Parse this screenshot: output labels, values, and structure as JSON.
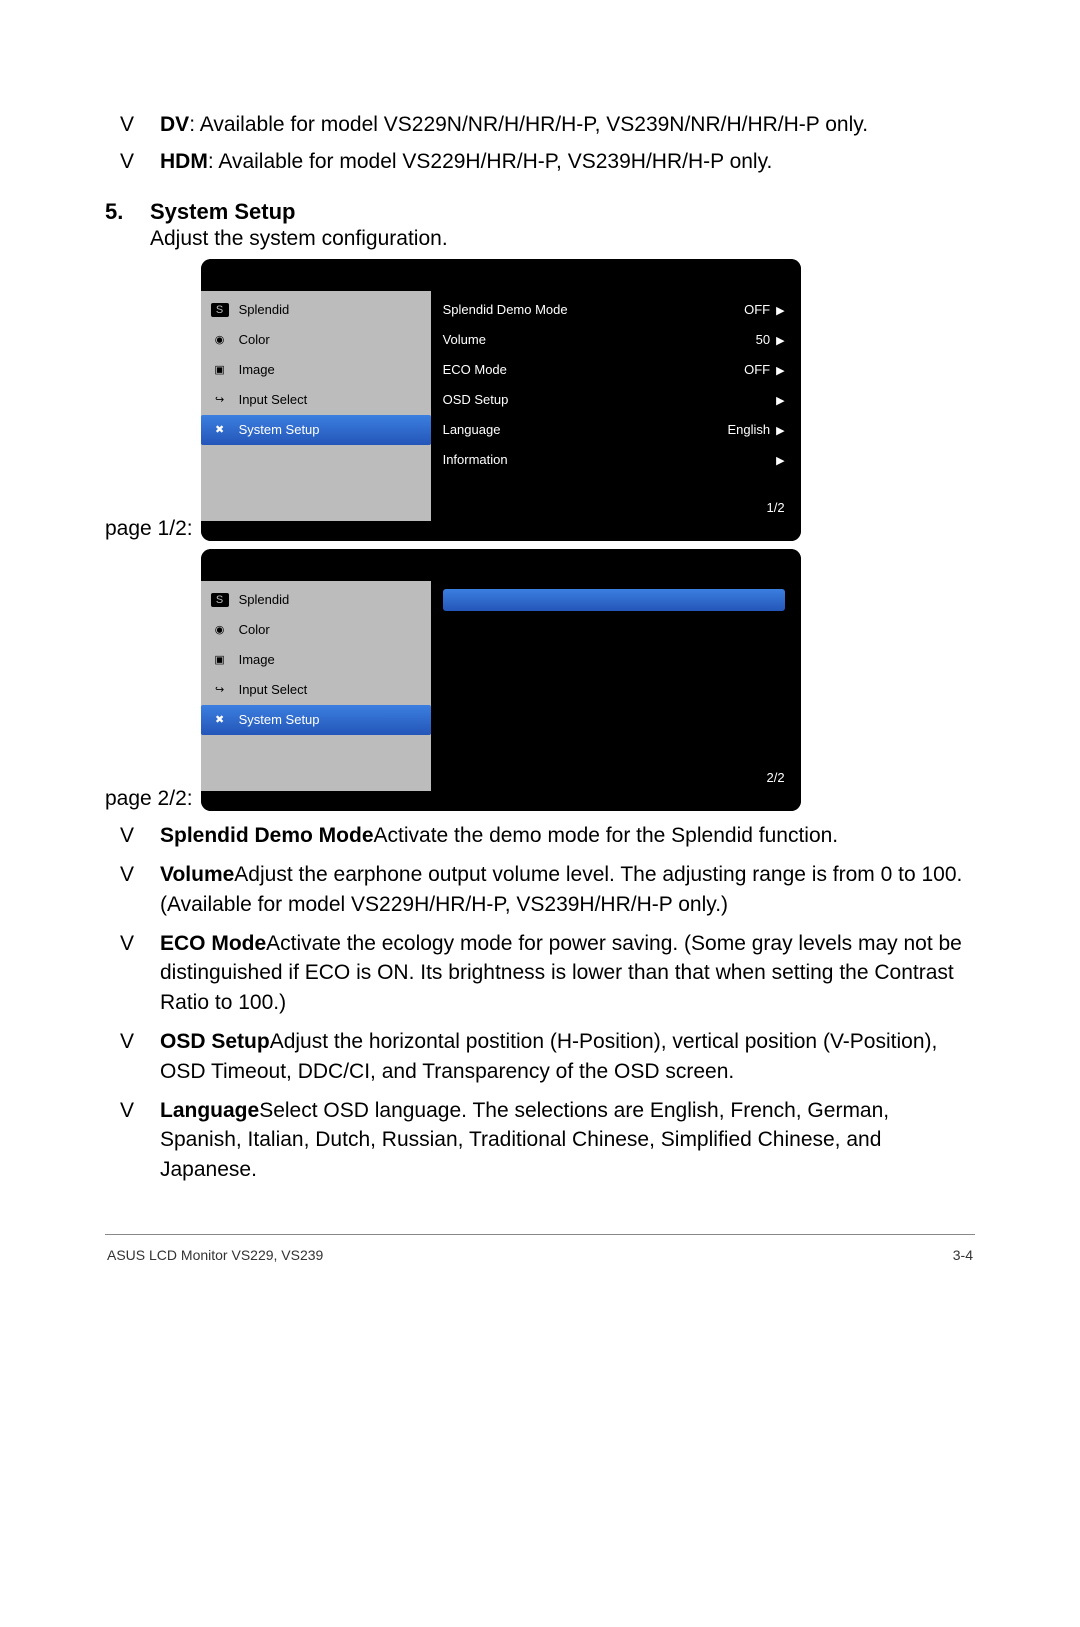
{
  "intro_bullets": [
    {
      "bold": "DV",
      "rest": ": Available for model VS229N/NR/H/HR/H-P, VS239N/NR/H/HR/H-P only."
    },
    {
      "bold": "HDM",
      "rest": ": Available for model VS229H/HR/H-P, VS239H/HR/H-P only."
    }
  ],
  "section": {
    "num": "5.",
    "title": "System Setup",
    "sub": "Adjust the system configuration."
  },
  "page1_label": "page 1/2:",
  "page2_label": "page 2/2:",
  "osd_menu": {
    "items": [
      "Splendid",
      "Color",
      "Image",
      "Input Select",
      "System Setup"
    ],
    "selected": 4,
    "right1": [
      {
        "label": "Splendid Demo Mode",
        "val": "OFF"
      },
      {
        "label": "Volume",
        "val": "50"
      },
      {
        "label": "ECO Mode",
        "val": "OFF"
      },
      {
        "label": "OSD Setup",
        "val": ""
      },
      {
        "label": "Language",
        "val": "English"
      },
      {
        "label": "Information",
        "val": ""
      }
    ],
    "ind1": "1/2",
    "ind2": "2/2"
  },
  "body_bullets": [
    {
      "bold": "Splendid Demo Mode",
      "rest": "Activate the demo mode for the Splendid function."
    },
    {
      "bold": "Volume",
      "rest": "Adjust the earphone output volume level. The adjusting range is from 0 to 100.(Available for model VS229H/HR/H-P, VS239H/HR/H-P only.)"
    },
    {
      "bold": "ECO Mode",
      "rest": "Activate the ecology mode for power saving. (Some gray levels may not be distinguished if ECO is ON. Its brightness is lower than that when setting the Contrast Ratio to 100.)"
    },
    {
      "bold": "OSD Setup",
      "rest": "Adjust the horizontal postition (H-Position), vertical position (V-Position), OSD Timeout, DDC/CI, and Transparency of the OSD screen."
    },
    {
      "bold": "Language",
      "rest": "Select OSD language. The selections are English, French, German, Spanish, Italian, Dutch, Russian, Traditional Chinese, Simplified Chinese, and Japanese."
    }
  ],
  "footer": {
    "left": "ASUS LCD Monitor VS229, VS239",
    "right": "3-4"
  }
}
